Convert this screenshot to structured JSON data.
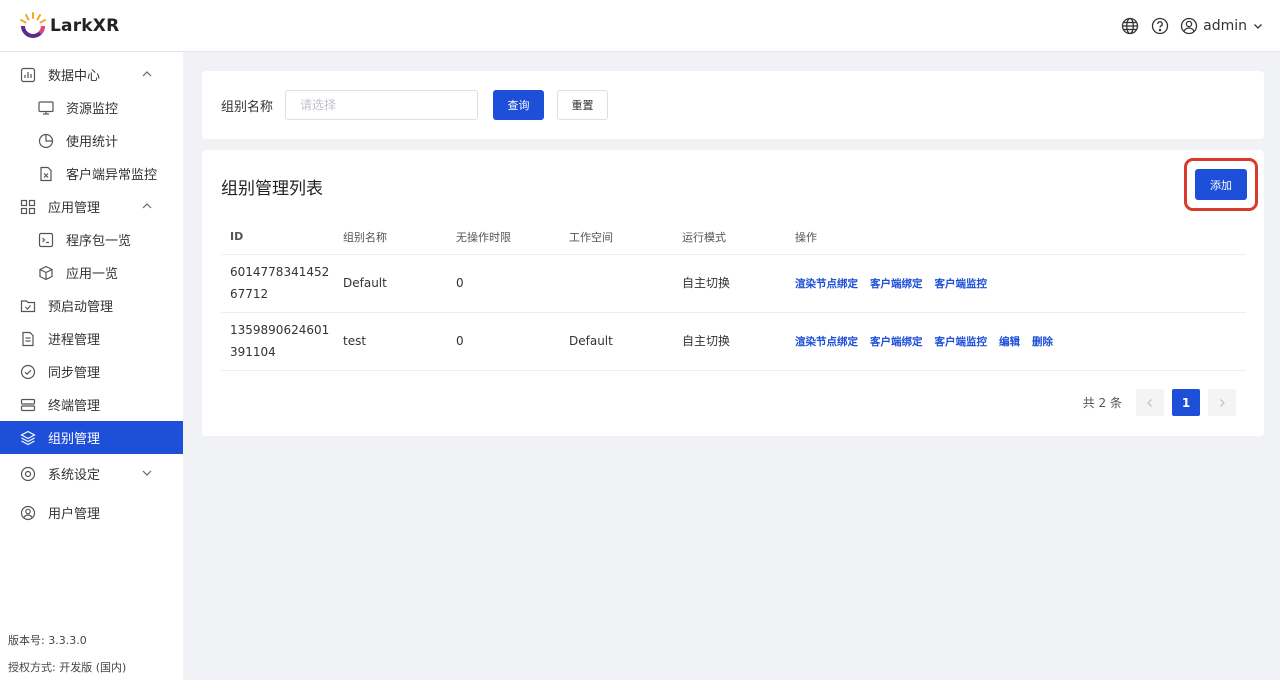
{
  "app": {
    "logo_text": "LarkXR",
    "user_name": "admin"
  },
  "sidebar": {
    "items": [
      {
        "label": "数据中心",
        "icon": "chart-icon"
      },
      {
        "label": "资源监控",
        "icon": "monitor-icon"
      },
      {
        "label": "使用统计",
        "icon": "pie-chart-icon"
      },
      {
        "label": "客户端异常监控",
        "icon": "file-error-icon"
      },
      {
        "label": "应用管理",
        "icon": "grid-icon"
      },
      {
        "label": "程序包一览",
        "icon": "terminal-icon"
      },
      {
        "label": "应用一览",
        "icon": "cube-icon"
      },
      {
        "label": "预启动管理",
        "icon": "folder-check-icon"
      },
      {
        "label": "进程管理",
        "icon": "document-icon"
      },
      {
        "label": "同步管理",
        "icon": "check-circle-icon"
      },
      {
        "label": "终端管理",
        "icon": "server-icon"
      },
      {
        "label": "组别管理",
        "icon": "layers-icon"
      },
      {
        "label": "系统设定",
        "icon": "settings-icon"
      },
      {
        "label": "用户管理",
        "icon": "user-icon"
      }
    ],
    "version": "版本号: 3.3.3.0",
    "license": "授权方式: 开发版 (国内)"
  },
  "search": {
    "label": "组别名称",
    "placeholder": "请选择",
    "query_label": "查询",
    "reset_label": "重置"
  },
  "list": {
    "title": "组别管理列表",
    "add_label": "添加",
    "columns": [
      "ID",
      "组别名称",
      "无操作时限",
      "工作空间",
      "运行模式",
      "操作"
    ],
    "rows": [
      {
        "id": "601477834145267712",
        "name": "Default",
        "timeout": "0",
        "workspace": "",
        "mode": "自主切换",
        "actions": [
          "渲染节点绑定",
          "客户端绑定",
          "客户端监控"
        ]
      },
      {
        "id": "1359890624601391104",
        "name": "test",
        "timeout": "0",
        "workspace": "Default",
        "mode": "自主切换",
        "actions": [
          "渲染节点绑定",
          "客户端绑定",
          "客户端监控",
          "编辑",
          "删除"
        ]
      }
    ]
  },
  "pagination": {
    "total_text": "共 2 条",
    "current_page": "1"
  },
  "colors": {
    "primary": "#1d4fd8",
    "highlight_border": "#d93a2b"
  }
}
